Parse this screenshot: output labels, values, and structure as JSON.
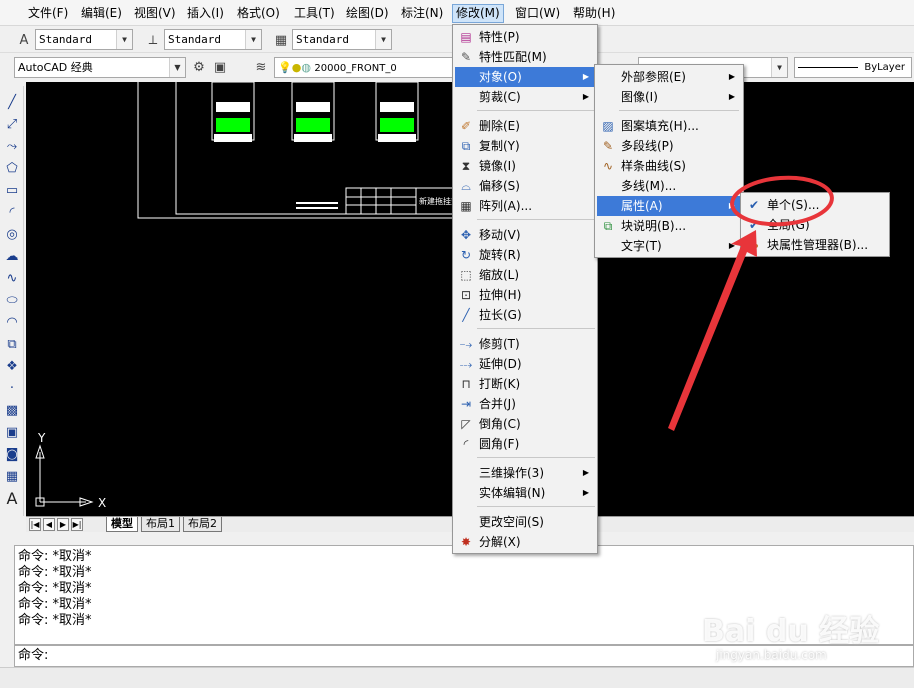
{
  "menubar": [
    "文件(F)",
    "编辑(E)",
    "视图(V)",
    "插入(I)",
    "格式(O)",
    "工具(T)",
    "绘图(D)",
    "标注(N)",
    "修改(M)",
    "窗口(W)",
    "帮助(H)"
  ],
  "toolbar1": {
    "text_style": "Standard",
    "dim_style": "Standard",
    "table_style": "Standard"
  },
  "toolbar2": {
    "workspace": "AutoCAD 经典",
    "layer": "20000_FRONT_0",
    "linetype": "ByLayer"
  },
  "modify_menu": {
    "items": [
      {
        "label": "特性(P)",
        "icon": "properties-icon"
      },
      {
        "label": "特性匹配(M)",
        "icon": "match-properties-icon"
      },
      {
        "label": "对象(O)",
        "icon": "",
        "submenu": true
      },
      {
        "label": "剪裁(C)",
        "icon": "",
        "submenu": true
      },
      {
        "label": "删除(E)",
        "icon": "erase-icon"
      },
      {
        "label": "复制(Y)",
        "icon": "copy-icon"
      },
      {
        "label": "镜像(I)",
        "icon": "mirror-icon"
      },
      {
        "label": "偏移(S)",
        "icon": "offset-icon"
      },
      {
        "label": "阵列(A)...",
        "icon": "array-icon"
      },
      {
        "label": "移动(V)",
        "icon": "move-icon"
      },
      {
        "label": "旋转(R)",
        "icon": "rotate-icon"
      },
      {
        "label": "缩放(L)",
        "icon": "scale-icon"
      },
      {
        "label": "拉伸(H)",
        "icon": "stretch-icon"
      },
      {
        "label": "拉长(G)",
        "icon": "lengthen-icon"
      },
      {
        "label": "修剪(T)",
        "icon": "trim-icon"
      },
      {
        "label": "延伸(D)",
        "icon": "extend-icon"
      },
      {
        "label": "打断(K)",
        "icon": "break-icon"
      },
      {
        "label": "合并(J)",
        "icon": "join-icon"
      },
      {
        "label": "倒角(C)",
        "icon": "chamfer-icon"
      },
      {
        "label": "圆角(F)",
        "icon": "fillet-icon"
      },
      {
        "label": "三维操作(3)",
        "icon": "",
        "submenu": true
      },
      {
        "label": "实体编辑(N)",
        "icon": "",
        "submenu": true
      },
      {
        "label": "更改空间(S)",
        "icon": ""
      },
      {
        "label": "分解(X)",
        "icon": "explode-icon"
      }
    ]
  },
  "object_menu": {
    "items": [
      {
        "label": "外部参照(E)",
        "submenu": true
      },
      {
        "label": "图像(I)",
        "submenu": true
      },
      {
        "label": "图案填充(H)...",
        "icon": "hatch-icon"
      },
      {
        "label": "多段线(P)",
        "icon": "polyline-icon"
      },
      {
        "label": "样条曲线(S)",
        "icon": "spline-icon"
      },
      {
        "label": "多线(M)..."
      },
      {
        "label": "属性(A)",
        "submenu": true
      },
      {
        "label": "块说明(B)...",
        "icon": "block-description-icon"
      },
      {
        "label": "文字(T)",
        "submenu": true
      }
    ]
  },
  "attribute_menu": {
    "items": [
      {
        "label": "单个(S)...",
        "icon": "single-attribute-icon"
      },
      {
        "label": "全局(G)",
        "icon": "global-attribute-icon"
      },
      {
        "label": "块属性管理器(B)...",
        "icon": "block-attribute-manager-icon"
      }
    ]
  },
  "layout_tabs": [
    "模型",
    "布局1",
    "布局2"
  ],
  "command_history": [
    "命令: *取消*",
    "命令: *取消*",
    "命令: *取消*",
    "命令: *取消*",
    "命令: *取消*"
  ],
  "command_prompt": "命令:",
  "ucs": {
    "x_label": "X",
    "y_label": "Y"
  },
  "drawing_title_text": "新建拖挂式",
  "watermark": {
    "brand": "Bai du 经验",
    "url": "jingyan.baidu.com"
  },
  "colors": {
    "highlight": "#3d7ad8",
    "canvas": "#000000",
    "annotation": "#e8353a",
    "drawing_green": "#00ff00"
  }
}
